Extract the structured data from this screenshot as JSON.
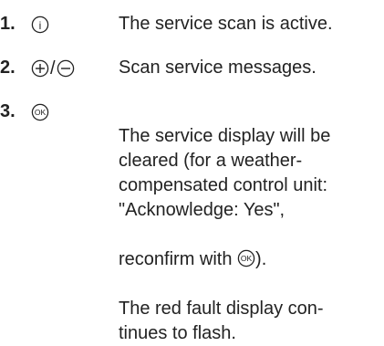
{
  "steps": [
    {
      "number": "1.",
      "icons": [
        "info-icon"
      ],
      "text": "The service scan is active."
    },
    {
      "number": "2.",
      "icons": [
        "plus-icon",
        "minus-icon"
      ],
      "separator": "/",
      "text": "Scan service messages."
    },
    {
      "number": "3.",
      "icons": [
        "ok-icon"
      ],
      "text_line1": "The service display will be\ncleared (for a weather-\ncompensated control unit:\n\"Acknowledge: Yes\",",
      "text_line2_prefix": "reconfirm with ",
      "inline_icon": "ok-icon",
      "text_line2_suffix": ").",
      "text_line3": "The red fault display con-\ntinues to flash."
    }
  ],
  "icon_labels": {
    "info": "i",
    "ok": "OK"
  }
}
